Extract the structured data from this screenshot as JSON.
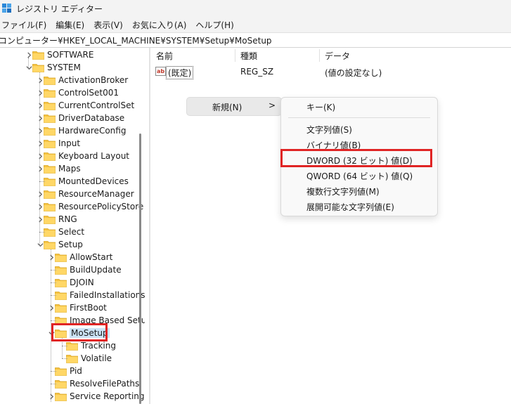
{
  "window": {
    "title": "レジストリ エディター"
  },
  "menubar": {
    "items": [
      "ファイル(F)",
      "編集(E)",
      "表示(V)",
      "お気に入り(A)",
      "ヘルプ(H)"
    ]
  },
  "address": {
    "path": "コンピューター¥HKEY_LOCAL_MACHINE¥SYSTEM¥Setup¥MoSetup"
  },
  "tree": {
    "items": [
      "SOFTWARE",
      "SYSTEM",
      "ActivationBroker",
      "ControlSet001",
      "CurrentControlSet",
      "DriverDatabase",
      "HardwareConfig",
      "Input",
      "Keyboard Layout",
      "Maps",
      "MountedDevices",
      "ResourceManager",
      "ResourcePolicyStore",
      "RNG",
      "Select",
      "Setup",
      "AllowStart",
      "BuildUpdate",
      "DJOIN",
      "FailedInstallations",
      "FirstBoot",
      "Image Based Setu",
      "MoSetup",
      "Tracking",
      "Volatile",
      "Pid",
      "ResolveFilePaths",
      "Service Reporting"
    ],
    "selected": "MoSetup"
  },
  "list": {
    "headers": {
      "name": "名前",
      "type": "種類",
      "data": "データ"
    },
    "rows": [
      {
        "name": "(既定)",
        "type": "REG_SZ",
        "data": "(値の設定なし)",
        "icon": "ab-string-icon"
      }
    ]
  },
  "context_menu": {
    "parent": {
      "label": "新規(N)",
      "arrow": ">"
    },
    "items": [
      "キー(K)",
      "文字列値(S)",
      "バイナリ値(B)",
      "DWORD (32 ビット) 値(D)",
      "QWORD (64 ビット) 値(Q)",
      "複数行文字列値(M)",
      "展開可能な文字列値(E)"
    ],
    "highlighted": "DWORD (32 ビット) 値(D)"
  },
  "colors": {
    "highlight_border": "#e02424",
    "folder": "#f5c242",
    "accent": "#0078d4"
  }
}
